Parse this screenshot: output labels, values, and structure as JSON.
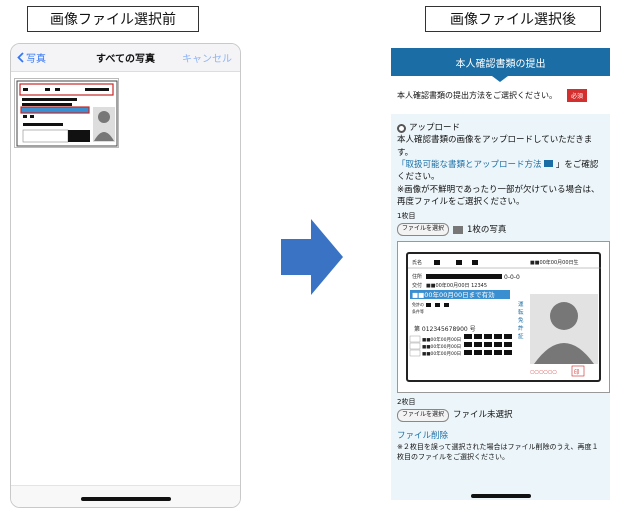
{
  "captions": {
    "before": "画像ファイル選択前",
    "after": "画像ファイル選択後"
  },
  "left_phone": {
    "back_label": "写真",
    "title": "すべての写真",
    "cancel_label": "キャンセル"
  },
  "right_phone": {
    "header_title": "本人確認書類の提出",
    "method_prompt": "本人確認書類の提出方法をご選択ください。",
    "required_badge": "必須",
    "upload_option": "アップロード",
    "instruction_1": "本人確認書類の画像をアップロードしていただきます。",
    "instruction_link": "「取扱可能な書類とアップロード方法",
    "instruction_2": "」をご確認ください。",
    "note_1": "※画像が不鮮明であったり一部が欠けている場合は、再度ファイルをご選択ください。",
    "first_label": "1枚目",
    "file_select_button": "ファイルを選択",
    "first_file_name": "1枚の写真",
    "second_label": "2枚目",
    "second_file_status": "ファイル未選択",
    "delete_link": "ファイル削除",
    "note_2": "※２枚目を誤って選択された場合はファイル削除のうえ、再度１枚目のファイルをご選択ください。"
  },
  "license_card": {
    "label_name": "氏名",
    "birth": "■■00年00月00日生",
    "label_address": "住所",
    "address_tail": "0-0-0",
    "issue": "■■00年00月00日  12345",
    "expiry": "■■00年00月00日まで有効",
    "vertical_text": "運転免許証",
    "number_label": "第",
    "number": "012345678900",
    "number_suffix": "号",
    "dates": [
      "■■00年00月00日",
      "■■00年00月00日",
      "■■00年00月00日"
    ],
    "seal": "印",
    "category_labels": [
      "二・小・原",
      "他",
      "二種"
    ]
  },
  "colors": {
    "header_blue": "#1a6ea5",
    "arrow_blue": "#3a73c4",
    "required_red": "#d32f2f",
    "link_blue": "#1a6ea5",
    "ios_blue": "#3477f6",
    "panel_bg": "#ecf5fa"
  }
}
